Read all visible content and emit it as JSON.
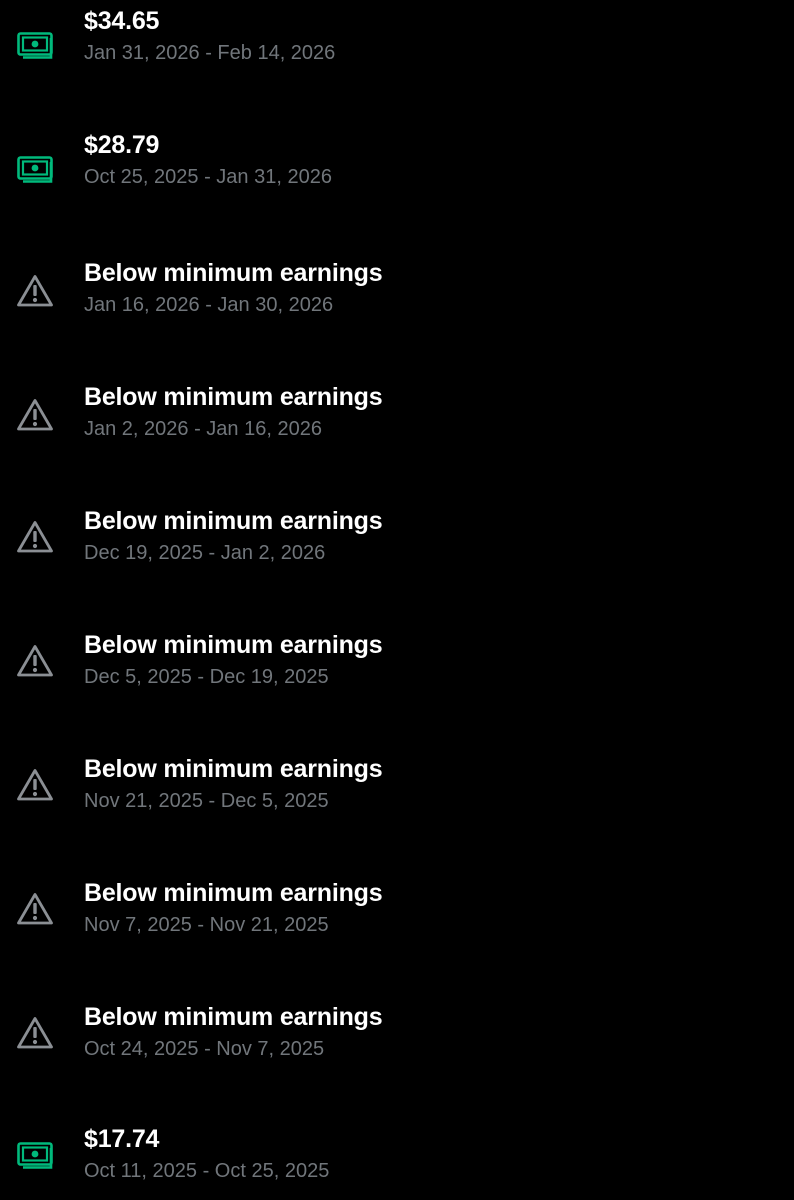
{
  "colors": {
    "background": "#000000",
    "title": "#ffffff",
    "subtitle": "#71767b",
    "money_icon": "#00ba7c",
    "warning_icon": "#8b8f94"
  },
  "payouts": [
    {
      "icon": "money-icon",
      "title": "$34.65",
      "period": "Jan 31, 2026 - Feb 14, 2026"
    },
    {
      "icon": "money-icon",
      "title": "$28.79",
      "period": "Oct 25, 2025 - Jan 31, 2026"
    },
    {
      "icon": "warning-icon",
      "title": "Below minimum earnings",
      "period": "Jan 16, 2026 - Jan 30, 2026"
    },
    {
      "icon": "warning-icon",
      "title": "Below minimum earnings",
      "period": "Jan 2, 2026 - Jan 16, 2026"
    },
    {
      "icon": "warning-icon",
      "title": "Below minimum earnings",
      "period": "Dec 19, 2025 - Jan 2, 2026"
    },
    {
      "icon": "warning-icon",
      "title": "Below minimum earnings",
      "period": "Dec 5, 2025 - Dec 19, 2025"
    },
    {
      "icon": "warning-icon",
      "title": "Below minimum earnings",
      "period": "Nov 21, 2025 - Dec 5, 2025"
    },
    {
      "icon": "warning-icon",
      "title": "Below minimum earnings",
      "period": "Nov 7, 2025 - Nov 21, 2025"
    },
    {
      "icon": "warning-icon",
      "title": "Below minimum earnings",
      "period": "Oct 24, 2025 - Nov 7, 2025"
    },
    {
      "icon": "money-icon",
      "title": "$17.74",
      "period": "Oct 11, 2025 - Oct 25, 2025"
    }
  ]
}
